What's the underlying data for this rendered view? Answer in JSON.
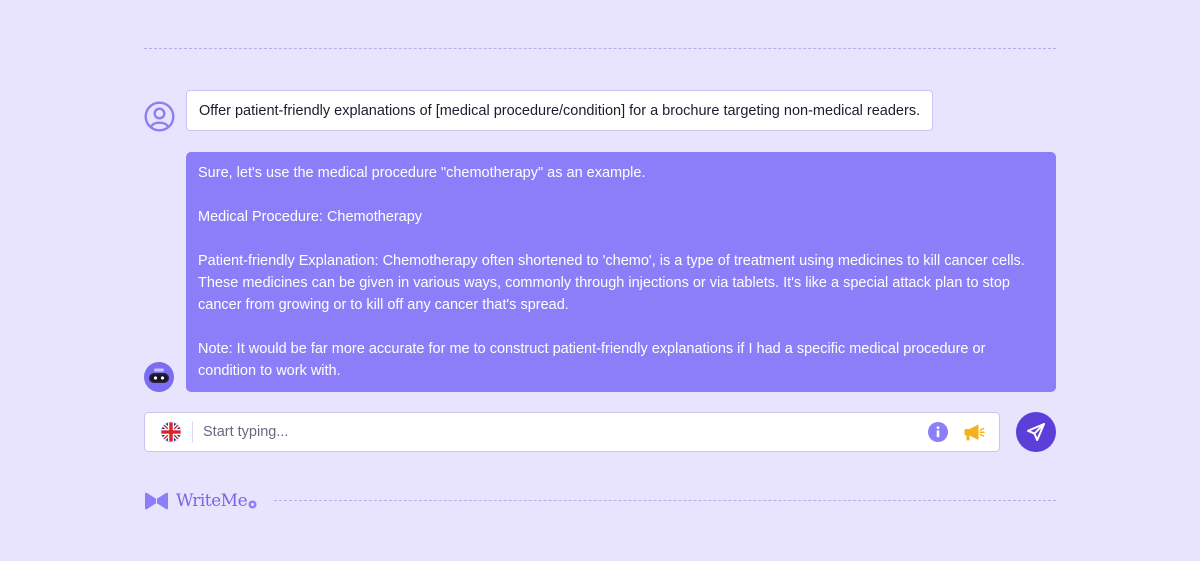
{
  "conversation": {
    "user_message": "Offer patient-friendly explanations of [medical procedure/condition] for a brochure targeting non-medical readers.",
    "bot_message": {
      "paragraph_1": "Sure, let's use the medical procedure \"chemotherapy\" as an example.",
      "paragraph_2": "Medical Procedure: Chemotherapy",
      "paragraph_3": "Patient-friendly Explanation: Chemotherapy often shortened to 'chemo', is a type of treatment using medicines to kill cancer cells. These medicines can be given in various ways, commonly through injections or via tablets. It's like a special attack plan to stop cancer from growing or to kill off any cancer that's spread.",
      "paragraph_4": "Note: It would be far more accurate for me to construct patient-friendly explanations if I had a specific medical procedure or condition to work with."
    }
  },
  "composer": {
    "placeholder": "Start typing...",
    "value": "",
    "language_icon": "uk-flag-icon",
    "info_icon": "info-icon",
    "announce_icon": "megaphone-icon",
    "send_icon": "send-icon"
  },
  "brand": {
    "name": "WriteMe",
    "logo_icon": "writeme-logo-icon"
  },
  "colors": {
    "background": "#e9e4fd",
    "bot_bubble": "#8b7ef8",
    "accent": "#5b3fd9",
    "brand": "#7566ea",
    "megaphone": "#f3b21b"
  }
}
